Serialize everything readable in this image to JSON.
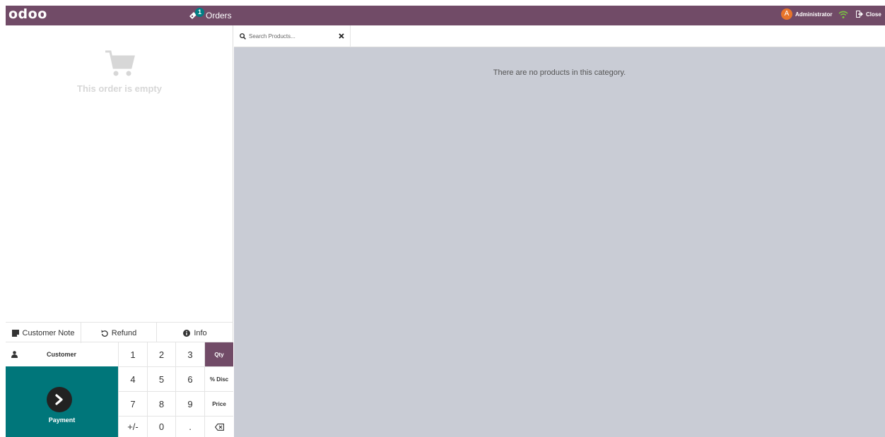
{
  "topbar": {
    "logo": "odoo",
    "orders_badge": "1",
    "orders_label": "Orders",
    "user_initial": "A",
    "user_name": "Administrator",
    "close_label": "Close",
    "colors": {
      "bar": "#714B67",
      "badge": "#017e84",
      "avatar": "#e8742a",
      "wifi": "#7ac144"
    }
  },
  "order": {
    "empty_text": "This order is empty"
  },
  "actions": [
    {
      "label": "Customer Note",
      "icon": "note-icon"
    },
    {
      "label": "Refund",
      "icon": "undo-icon"
    },
    {
      "label": "Info",
      "icon": "info-icon"
    }
  ],
  "customer_label": "Customer",
  "payment_label": "Payment",
  "keypad": {
    "keys": [
      "1",
      "2",
      "3",
      "Qty",
      "4",
      "5",
      "6",
      "% Disc",
      "7",
      "8",
      "9",
      "Price",
      "+/-",
      "0",
      ".",
      ""
    ],
    "active_mode": "Qty",
    "backspace_icon": "backspace-icon"
  },
  "search": {
    "placeholder": "Search Products..."
  },
  "products": {
    "empty_message": "There are no products in this category."
  },
  "colors": {
    "payment": "#00767a",
    "products_bg": "#c9ccd5"
  }
}
